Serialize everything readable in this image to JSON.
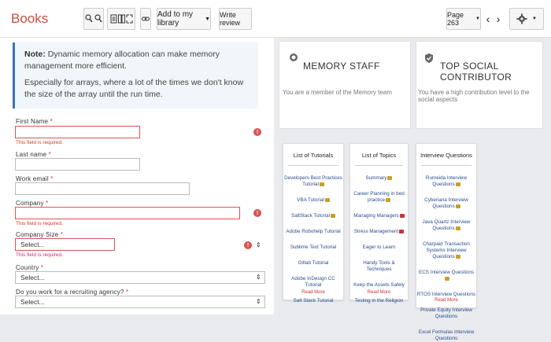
{
  "toolbar": {
    "brand": "Books",
    "add_to_library": "Add to my library",
    "write_review": "Write review",
    "page": "Page 263"
  },
  "note": {
    "label": "Note:",
    "line1": "Dynamic memory allocation can make memory management more efficient.",
    "line2": "Especially for arrays, where a lot of the times we don't know the size of the array until the run time."
  },
  "form": {
    "first_name": "First Name",
    "last_name": "Last name",
    "work_email": "Work email",
    "company": "Company",
    "company_size": "Company Size",
    "country": "Country",
    "recruiting": "Do you work for a recruiting agency?",
    "required_msg": "This field is required.",
    "select_placeholder": "Select..."
  },
  "badges": [
    {
      "title": "MEMORY STAFF",
      "subtitle": "You are a member of the Memory team"
    },
    {
      "title": "TOP SOCIAL CONTRIBUTOR",
      "subtitle": "You have a high contribution level to the social aspects"
    }
  ],
  "lists": [
    {
      "title": "List of Tutorials",
      "items": [
        "Developers Best Practices Tutorial",
        "VBA Tutorial",
        "SaltStack Tutorial",
        "Adobe Robohelp Tutorial",
        "Sublime Text Tutorial",
        "Gitlab Tutorial",
        "Adobe InDesign CC Tutorial",
        "Salt Stack Tutorial"
      ],
      "more": "Read More"
    },
    {
      "title": "List of Topics",
      "items": [
        "Summary",
        "Career Planning in bed practice",
        "Managing Managers",
        "Stress Management",
        "Eager to Learn",
        "Handy Tools & Techniques",
        "Keep the Assets Safely",
        "Testing in the Religion"
      ],
      "more": "Read More"
    },
    {
      "title": "Interview Questions",
      "items": [
        "Rumeida Interview Questions",
        "Cyberiana Interview Questions",
        "Java Quartz Interview Questions",
        "Charpaid Transaction Systems Interview Questions",
        "ECS Interview Questions",
        "RTOS Interview Questions",
        "Private Equity Interview Questions",
        "Excel Formulas Interview Questions"
      ],
      "more": "Read More"
    }
  ]
}
